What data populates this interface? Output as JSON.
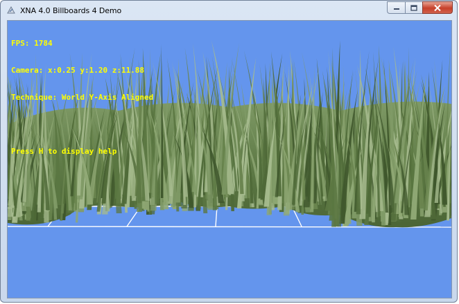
{
  "window": {
    "title": "XNA 4.0 Billboards 4 Demo",
    "icon": "xna-app-icon"
  },
  "hud": {
    "fps": "FPS: 1784",
    "camera": "Camera: x:0.25 y:1.20 z:11.88",
    "technique": "Technique: World Y-Axis Aligned",
    "help": "Press H to display help"
  },
  "colors": {
    "background": "#6495ed",
    "hud_text": "#ffff00",
    "grass_dark": "#4f6a38",
    "grass_light": "#8fa874",
    "grid_line": "#ffffff"
  }
}
